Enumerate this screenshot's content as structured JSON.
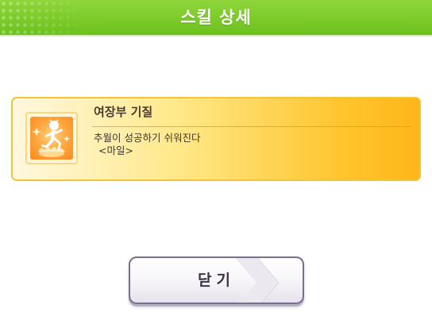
{
  "header": {
    "title": "스킬 상세"
  },
  "skill": {
    "name": "여장부 기질",
    "description": "추월이 성공하기 쉬워진다",
    "condition": "<마일>",
    "icon": "running-figure-icon"
  },
  "footer": {
    "close_label": "닫기"
  },
  "colors": {
    "header_green": "#7ccb2a",
    "card_gold": "#ffc52f",
    "button_border": "#7a6d8d"
  }
}
